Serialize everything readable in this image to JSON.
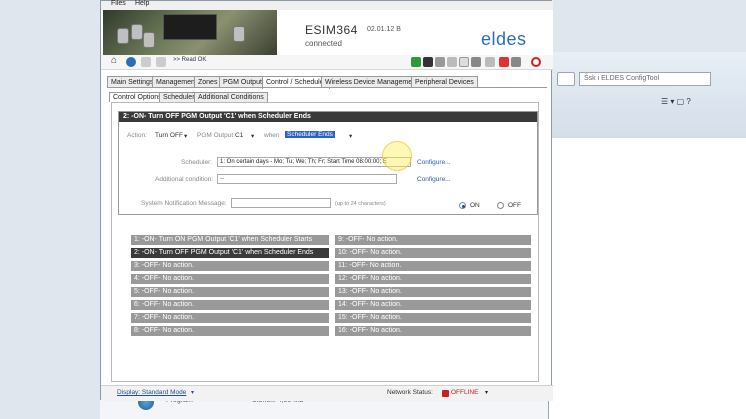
{
  "bg": {
    "search_placeholder": "Šsk i ELDES ConfigTool",
    "program": "Program",
    "storage": "Storlek: 4,50 MB"
  },
  "menu": [
    "Files",
    "Help"
  ],
  "device": {
    "model": "ESIM364",
    "version": "02.01.12 B",
    "status": "connected",
    "brand": "eldes"
  },
  "toolbar": {
    "read_status": ">> Read OK"
  },
  "tabs": [
    "Main Settings",
    "Management",
    "Zones",
    "PGM Outputs",
    "Control / Scheduler",
    "Wireless Device Management",
    "Peripheral Devices"
  ],
  "subtabs": [
    "Control Options",
    "Scheduler",
    "Additional Conditions"
  ],
  "rule": {
    "title": "2: -ON-  Turn OFF PGM Output 'C1' when Scheduler Ends",
    "action_label": "Action:",
    "action_value": "Turn OFF",
    "output_label": "PGM Output",
    "output_value": "C1",
    "when_label": "when",
    "when_value": "Scheduler Ends",
    "scheduler_label": "Scheduler:",
    "scheduler_value": "1: On certain days - Mo; Tu; We; Th; Fr; Start Time 08:00:00; E",
    "configure1": "Configure...",
    "cond_label": "Additional condition:",
    "cond_value": "--",
    "configure2": "Configure...",
    "notify_label": "System Notification Message:",
    "notify_hint": "(up to 24 characters)",
    "on_label": "ON",
    "off_label": "OFF",
    "notify_state": "ON"
  },
  "rules_left": [
    "1: -ON-  Turn ON PGM Output 'C1' when Scheduler Starts",
    "2: -ON-  Turn OFF PGM Output 'C1' when Scheduler Ends",
    "3: -OFF- No action.",
    "4: -OFF- No action.",
    "5: -OFF- No action.",
    "6: -OFF- No action.",
    "7: -OFF- No action.",
    "8: -OFF- No action."
  ],
  "rules_right": [
    "9: -OFF- No action.",
    "10: -OFF- No action.",
    "11: -OFF- No action.",
    "12: -OFF- No action.",
    "13: -OFF- No action.",
    "14: -OFF- No action.",
    "15: -OFF- No action.",
    "16: -OFF- No action."
  ],
  "statusbar": {
    "display": "Display: Standard Mode",
    "network_label": "Network Status:",
    "network_value": "OFFLINE"
  },
  "colors": {
    "accent": "#2f62c8",
    "rule_active": "#3a3a3a",
    "rule_inactive": "#999999",
    "offline": "#c62020",
    "brand": "#2a6fb5"
  }
}
